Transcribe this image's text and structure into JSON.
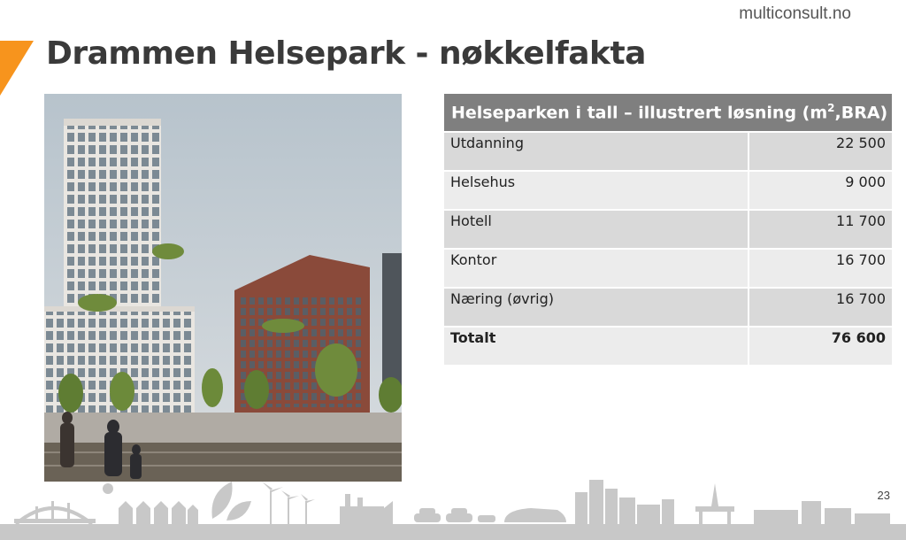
{
  "header": {
    "brand": "multiconsult.no",
    "title": "Drammen Helsepark - nøkkelfakta"
  },
  "table": {
    "heading_prefix": "Helseparken i tall – illustrert løsning (m",
    "heading_sup": "2",
    "heading_suffix": ",BRA)",
    "rows": [
      {
        "label": "Utdanning",
        "value": "22 500"
      },
      {
        "label": "Helsehus",
        "value": "9 000"
      },
      {
        "label": "Hotell",
        "value": "11 700"
      },
      {
        "label": "Kontor",
        "value": "16 700"
      },
      {
        "label": "Næring (øvrig)",
        "value": "16 700"
      }
    ],
    "total": {
      "label": "Totalt",
      "value": "76 600"
    }
  },
  "footer": {
    "page_number": "23"
  },
  "colors": {
    "accent": "#f7941d",
    "table_header": "#7f7f7f",
    "row_dark": "#d9d9d9",
    "row_light": "#ececec",
    "skyline": "#c8c8c8"
  }
}
